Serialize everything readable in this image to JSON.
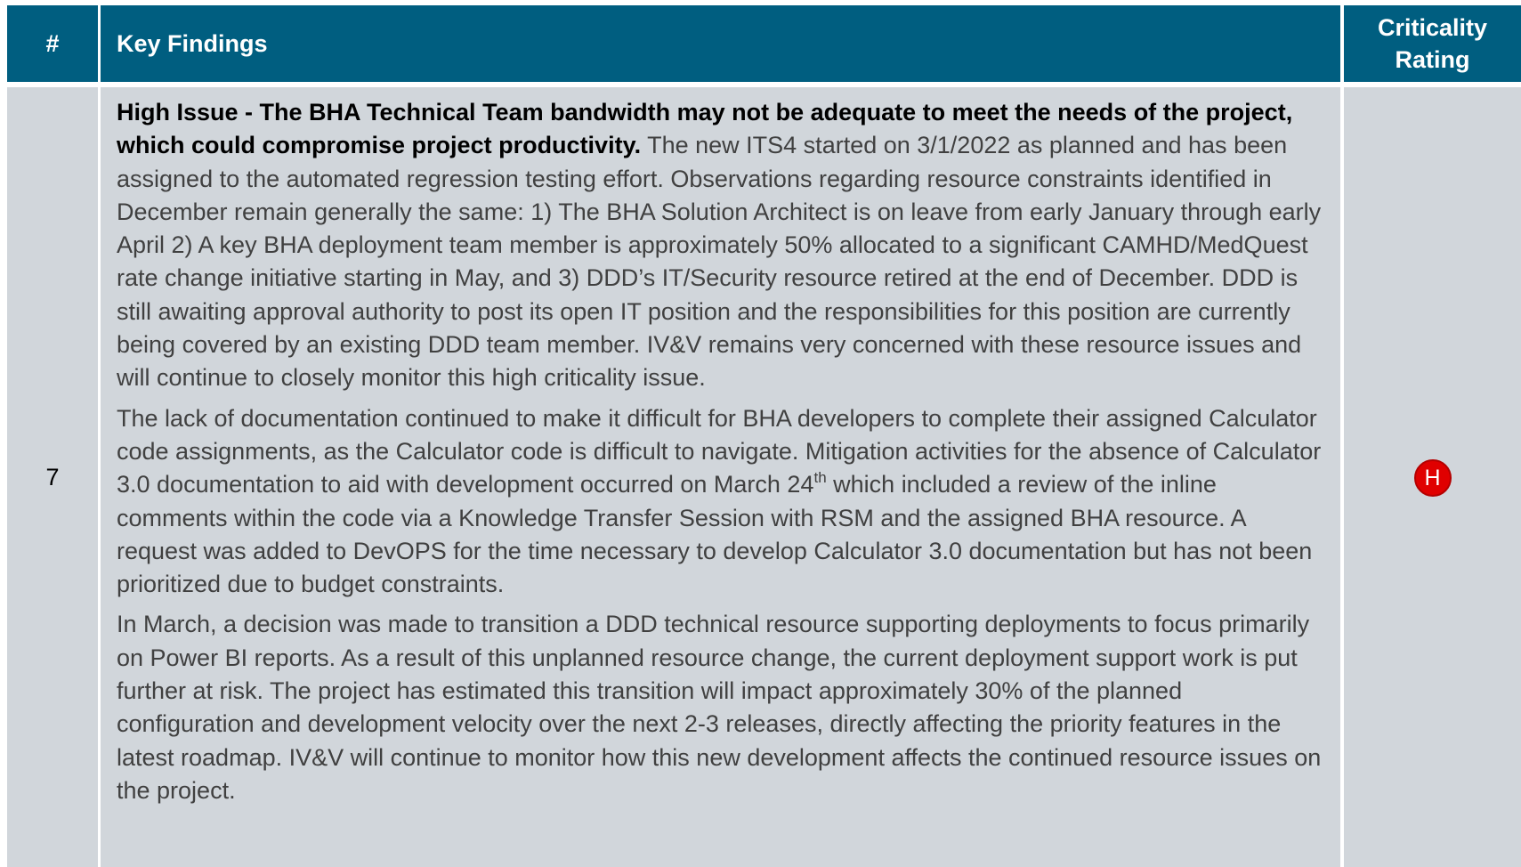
{
  "header": {
    "num": "#",
    "findings": "Key Findings",
    "criticality_line1": "Criticality",
    "criticality_line2": "Rating"
  },
  "row": {
    "num": "7",
    "p1_bold": "High Issue - The BHA Technical Team bandwidth may not be adequate to meet the needs of the project, which could compromise project productivity.",
    "p1_text": " The new ITS4 started on 3/1/2022 as planned and has been assigned to the automated regression testing effort.  Observations regarding resource constraints identified in December remain generally the same: 1) The BHA Solution Architect is on leave from early January through early April 2) A key BHA deployment team member is approximately 50% allocated to a significant CAMHD/MedQuest rate change initiative starting in May, and 3) DDD’s IT/Security resource retired at the end of December. DDD is still awaiting approval authority to post its open IT position and the responsibilities for this position are currently being covered by an existing DDD team member. IV&V remains very concerned with these resource issues and will continue to closely monitor this high criticality issue.",
    "p2_a": "The lack of documentation continued to make it difficult for BHA developers to complete their assigned Calculator code assignments, as the Calculator code is difficult to navigate. Mitigation activities for the absence of Calculator 3.0 documentation to aid with development occurred on March 24",
    "p2_sup": "th",
    "p2_b": " which included a review of the inline comments within the code via a Knowledge Transfer Session with RSM and the assigned BHA resource. A request was added to DevOPS for the time necessary to develop Calculator 3.0 documentation but has not been prioritized due to budget constraints.",
    "p3": "In March, a decision was made to transition a DDD technical resource supporting deployments to focus primarily on Power BI reports. As a result of this unplanned resource change, the current deployment support work is put further at risk. The project has estimated this transition will impact approximately 30% of the planned configuration and development velocity over the next 2-3 releases, directly affecting the priority features in the latest roadmap.  IV&V will continue to monitor how this new development affects the continued resource issues on the project.",
    "rating": "H",
    "rating_color": "#e00000"
  },
  "colors": {
    "header_bg": "#005e80",
    "body_bg": "#d1d6db"
  }
}
